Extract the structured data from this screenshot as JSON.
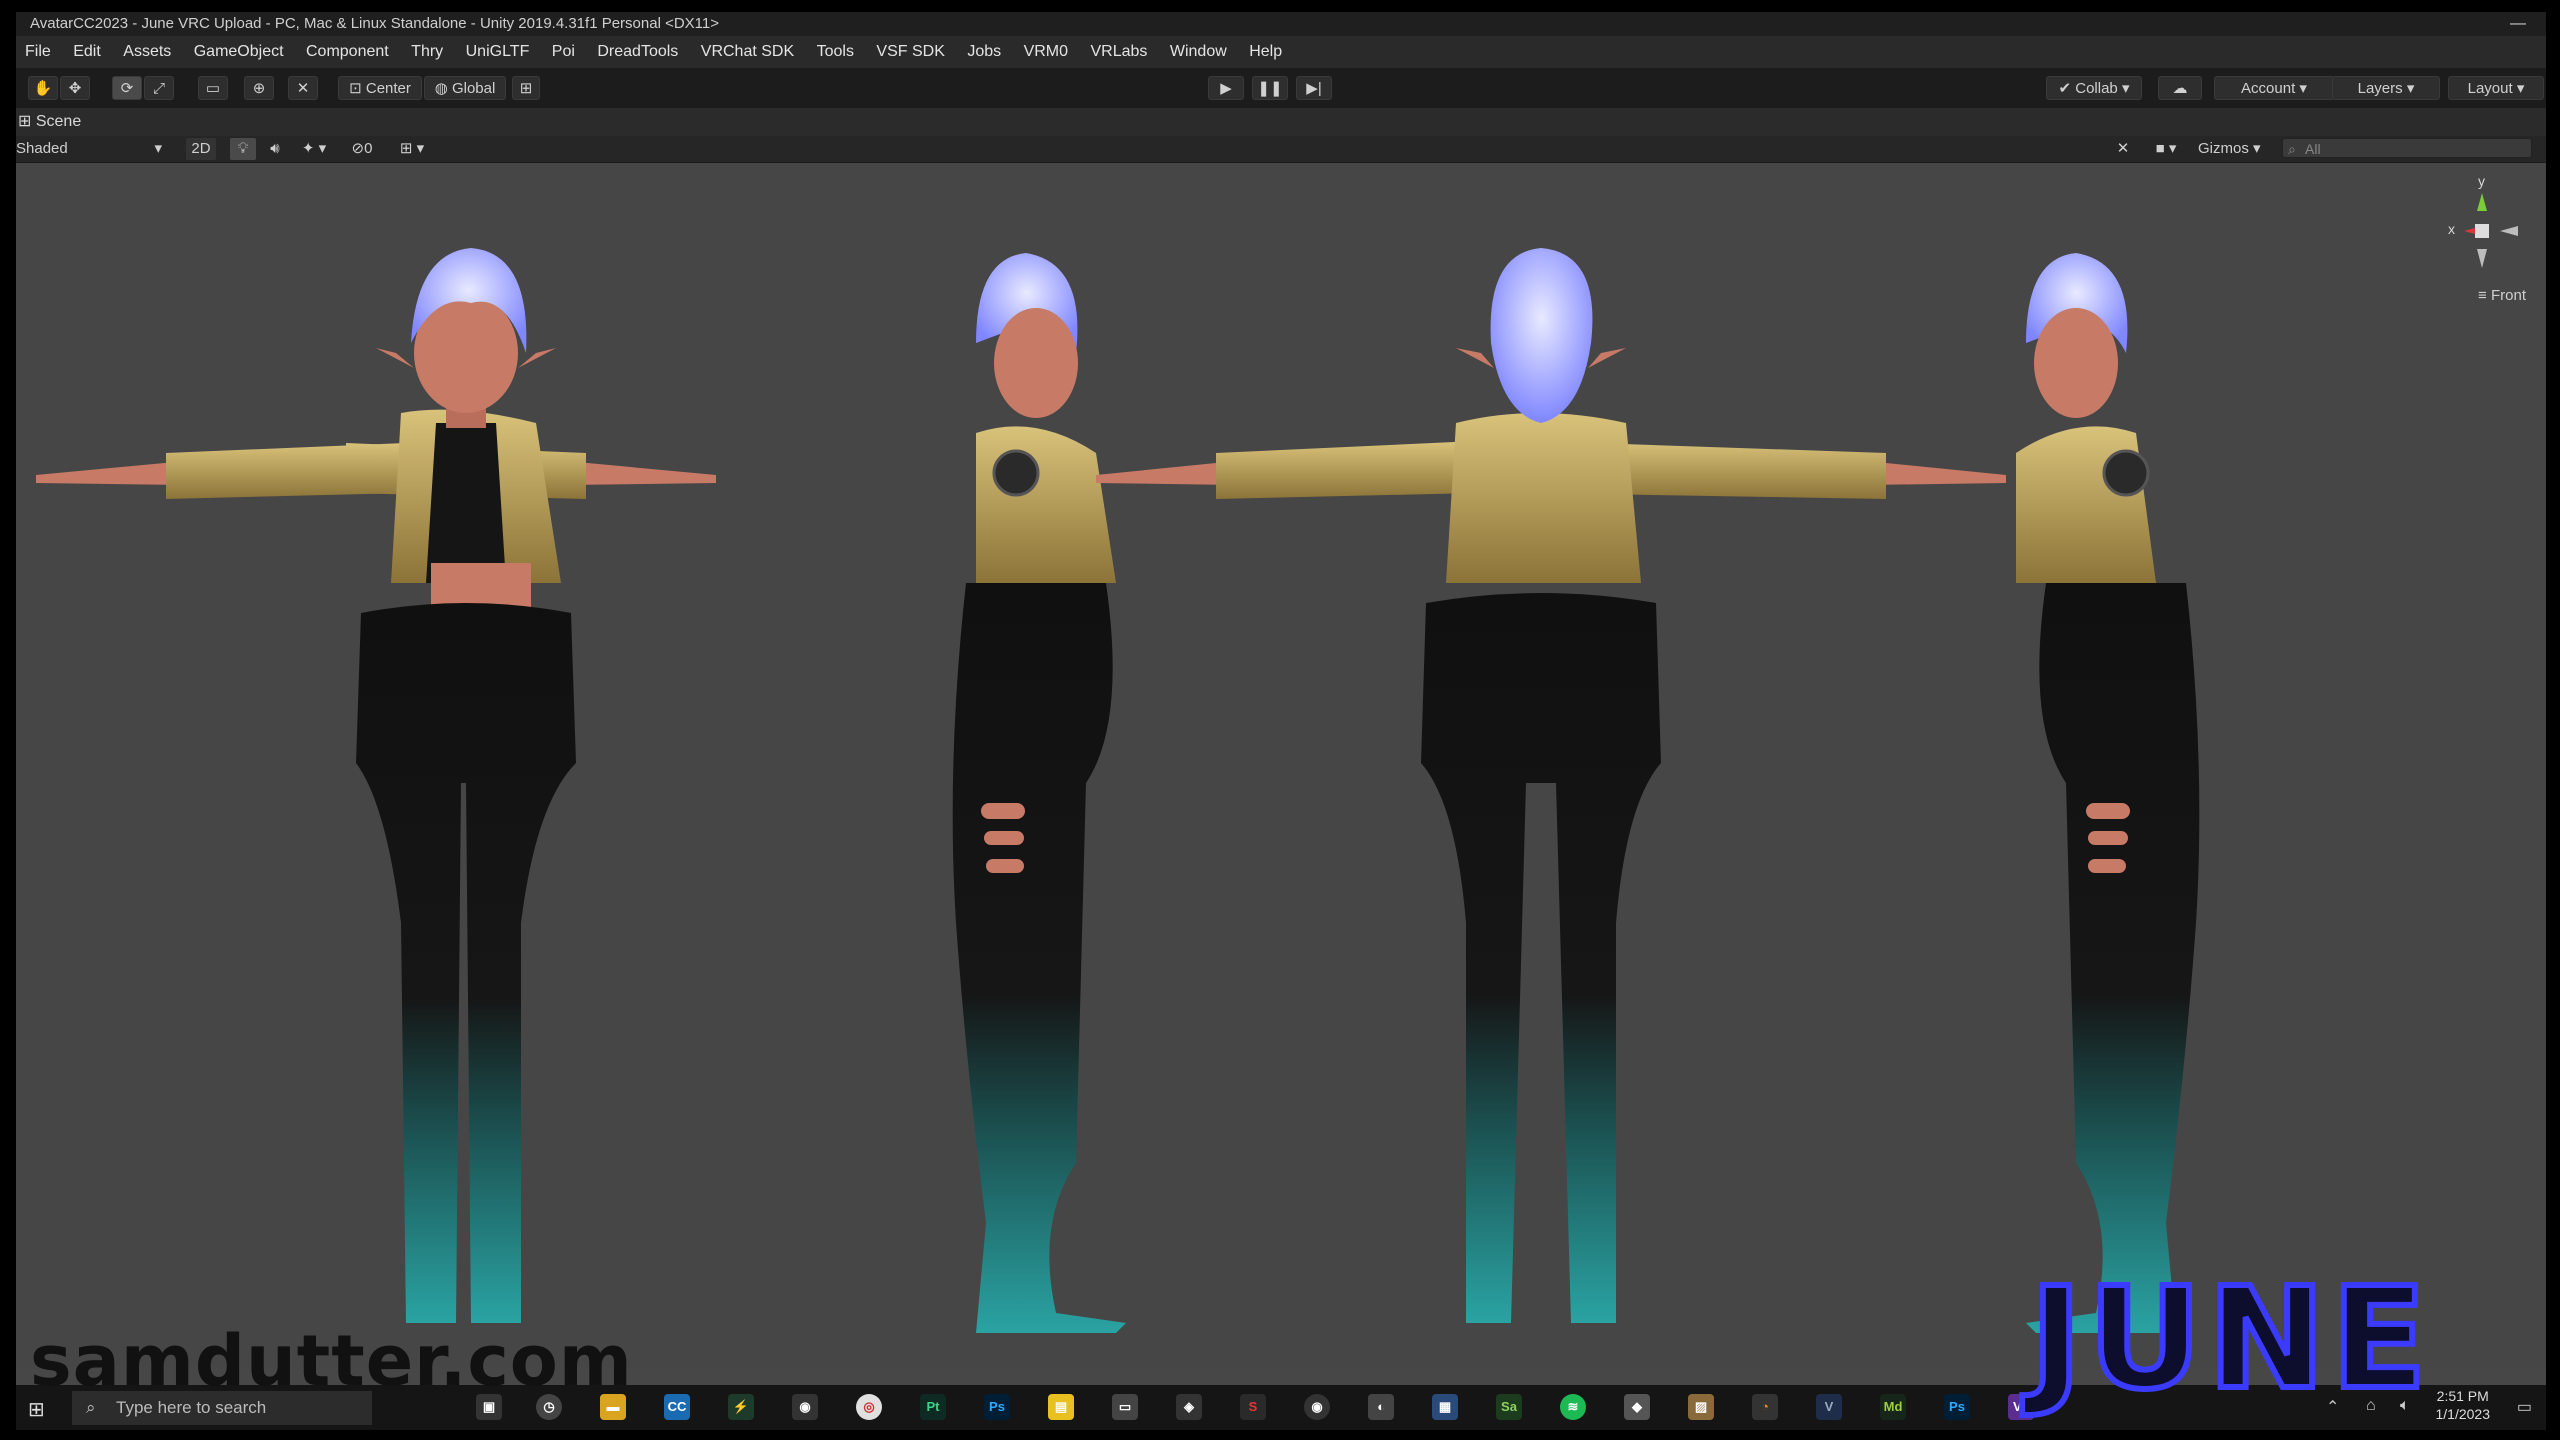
{
  "window": {
    "title": "AvatarCC2023 - June VRC Upload - PC, Mac & Linux Standalone - Unity 2019.4.31f1 Personal <DX11>"
  },
  "menu": [
    "File",
    "Edit",
    "Assets",
    "GameObject",
    "Component",
    "Thry",
    "UniGLTF",
    "Poi",
    "DreadTools",
    "VRChat SDK",
    "Tools",
    "VSF SDK",
    "Jobs",
    "VRM0",
    "VRLabs",
    "Window",
    "Help"
  ],
  "toolbar": {
    "pivot_label": "Center",
    "space_label": "Global",
    "collab_label": "Collab",
    "account_label": "Account",
    "layers_label": "Layers",
    "layout_label": "Layout"
  },
  "scene": {
    "tab_label": "Scene",
    "shading_mode": "Shaded",
    "mode_2d": "2D",
    "hidden_count": "0",
    "gizmos_label": "Gizmos",
    "search_placeholder": "All",
    "view_label": "Front",
    "axis_y": "y",
    "axis_x": "x"
  },
  "overlay": {
    "watermark": "samdutter.com",
    "character_name": "JUNE"
  },
  "taskbar": {
    "search_placeholder": "Type here to search",
    "time": "2:51 PM",
    "date": "1/1/2023",
    "apps": [
      "CC",
      "Pt",
      "Ps",
      "Sa",
      "Md",
      "Ps",
      "Vs"
    ]
  },
  "colors": {
    "accent_blue": "#3b3bff",
    "skin": "#c77a66",
    "hair": "#aab0ff",
    "jacket_gold": "#b59a52",
    "pants_black": "#121212",
    "boots_teal": "#2a9a9a"
  }
}
